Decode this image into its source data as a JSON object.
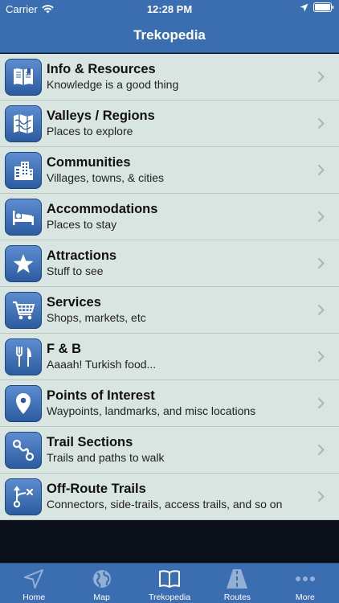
{
  "status": {
    "carrier": "Carrier",
    "time": "12:28 PM"
  },
  "nav": {
    "title": "Trekopedia"
  },
  "items": [
    {
      "title": "Info & Resources",
      "subtitle": "Knowledge is a good thing",
      "icon": "book-icon"
    },
    {
      "title": "Valleys / Regions",
      "subtitle": "Places to explore",
      "icon": "map-icon"
    },
    {
      "title": "Communities",
      "subtitle": "Villages, towns, & cities",
      "icon": "buildings-icon"
    },
    {
      "title": "Accommodations",
      "subtitle": "Places to stay",
      "icon": "bed-icon"
    },
    {
      "title": "Attractions",
      "subtitle": "Stuff to see",
      "icon": "star-icon"
    },
    {
      "title": "Services",
      "subtitle": "Shops, markets, etc",
      "icon": "cart-icon"
    },
    {
      "title": "F & B",
      "subtitle": "Aaaah! Turkish food...",
      "icon": "fork-knife-icon"
    },
    {
      "title": "Points of Interest",
      "subtitle": "Waypoints, landmarks, and misc locations",
      "icon": "map-pin-icon"
    },
    {
      "title": "Trail Sections",
      "subtitle": "Trails and paths to walk",
      "icon": "route-icon"
    },
    {
      "title": "Off-Route Trails",
      "subtitle": "Connectors, side-trails, access trails, and so on",
      "icon": "branch-icon"
    }
  ],
  "tabs": [
    {
      "label": "Home",
      "icon": "compass-arrow-icon"
    },
    {
      "label": "Map",
      "icon": "globe-icon"
    },
    {
      "label": "Trekopedia",
      "icon": "book-icon"
    },
    {
      "label": "Routes",
      "icon": "road-icon"
    },
    {
      "label": "More",
      "icon": "ellipsis-icon"
    }
  ],
  "colors": {
    "bar": "#3b6eb0",
    "row": "#d8e5e1",
    "icon_tile": "#3b6eb0"
  }
}
